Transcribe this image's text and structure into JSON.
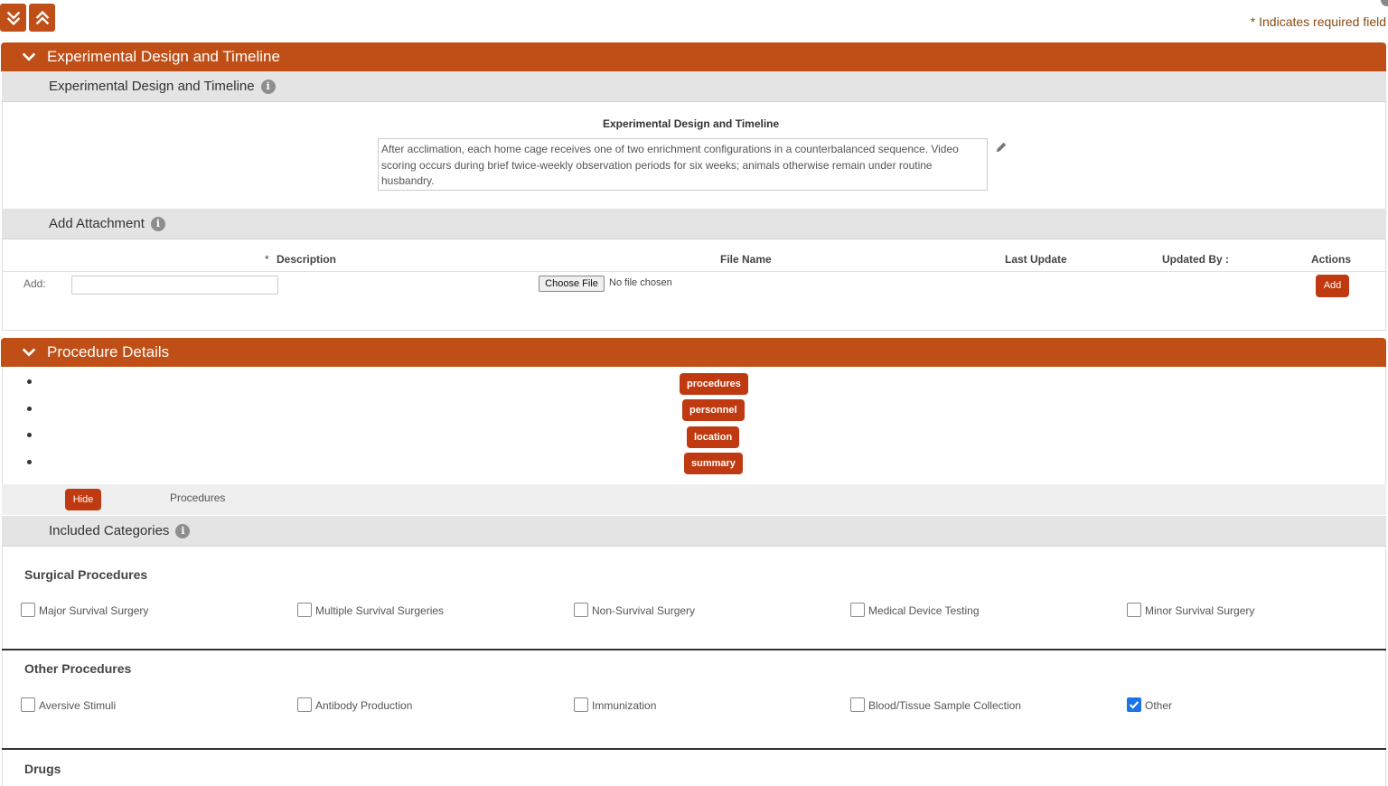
{
  "header": {
    "required_note": "* Indicates required field"
  },
  "sections": {
    "experimental": {
      "title": "Experimental Design and Timeline",
      "subheader": "Experimental Design and Timeline",
      "field_title": "Experimental Design and Timeline",
      "text": "After acclimation, each home cage receives one of two enrichment configurations in a counterbalanced sequence. Video scoring occurs during brief twice-weekly observation periods for six weeks; animals otherwise remain under routine husbandry."
    },
    "attachment": {
      "subheader": "Add Attachment",
      "columns": {
        "description": "Description",
        "required_mark": "*",
        "file_name": "File Name",
        "last_update": "Last Update",
        "updated_by": "Updated By :",
        "actions": "Actions"
      },
      "add_label": "Add:",
      "choose_file": "Choose File",
      "no_file": "No file chosen",
      "add_button": "Add"
    },
    "procedure": {
      "title": "Procedure Details",
      "buttons": [
        "procedures",
        "personnel",
        "location",
        "summary"
      ],
      "hide_button": "Hide",
      "procedures_label": "Procedures",
      "included_subheader": "Included Categories"
    }
  },
  "categories": {
    "surgical": {
      "heading": "Surgical Procedures",
      "items": [
        {
          "label": "Major Survival Surgery",
          "checked": false
        },
        {
          "label": "Multiple Survival Surgeries",
          "checked": false
        },
        {
          "label": "Non-Survival Surgery",
          "checked": false
        },
        {
          "label": "Medical Device Testing",
          "checked": false
        },
        {
          "label": "Minor Survival Surgery",
          "checked": false
        }
      ]
    },
    "other": {
      "heading": "Other Procedures",
      "items": [
        {
          "label": "Aversive Stimuli",
          "checked": false
        },
        {
          "label": "Antibody Production",
          "checked": false
        },
        {
          "label": "Immunization",
          "checked": false
        },
        {
          "label": "Blood/Tissue Sample Collection",
          "checked": false
        },
        {
          "label": "Other",
          "checked": true
        }
      ]
    },
    "drugs": {
      "heading": "Drugs"
    }
  },
  "colors": {
    "accent": "#bf4f17",
    "button": "#bf3a10",
    "checkbox_checked": "#1a73e8"
  }
}
